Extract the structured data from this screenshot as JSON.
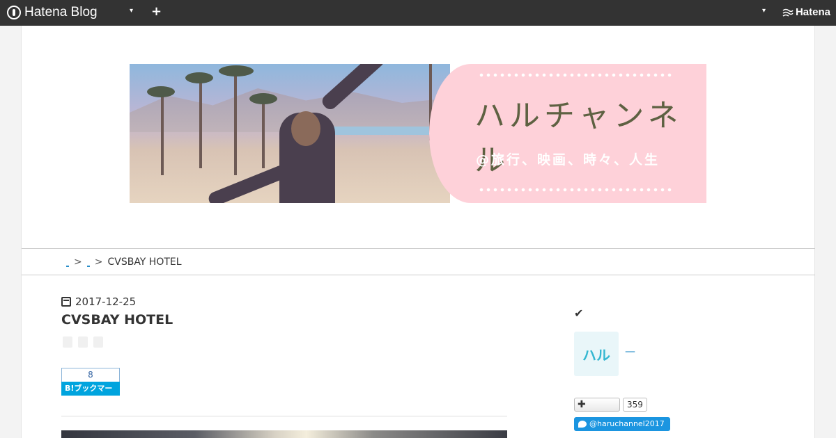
{
  "topbar": {
    "brand": "Hatena Blog",
    "plus_label": "+",
    "right_caret": "▾",
    "caret": "▾",
    "hatena": "Hatena"
  },
  "banner": {
    "title": "ハルチャンネル",
    "subtitle": "@旅行、映画、時々、人生"
  },
  "breadcrumb": {
    "separator": ">",
    "current": "CVSBAY HOTEL"
  },
  "entry": {
    "date": "2017-12-25",
    "title": "CVSBAY HOTEL",
    "bookmark_count": "8",
    "bookmark_label": "B!ブックマーク"
  },
  "sidebar": {
    "check": "✔",
    "avatar_text": "ハル",
    "profile_name": "—",
    "follow_label": "✚",
    "follow_count": "359",
    "twitter_handle": "@haruchannel2017"
  },
  "colors": {
    "topbar": "#333333",
    "banner_pink": "#fed1d9",
    "link": "#2a8ec9",
    "bookmark": "#00a4de",
    "twitter": "#1b95e0"
  }
}
